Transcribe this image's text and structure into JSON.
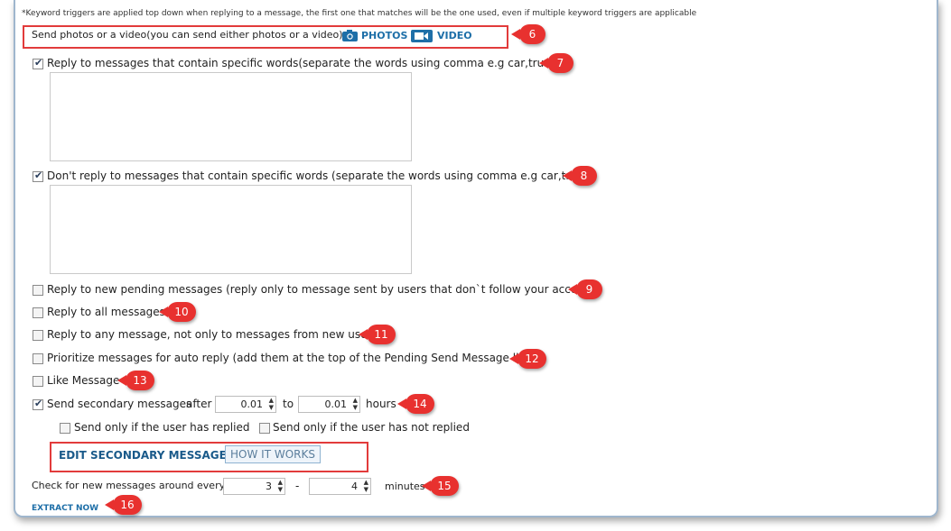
{
  "note": "*Keyword triggers are applied top down when replying to a message, the first one that matches will be the one used, even if multiple keyword triggers are applicable",
  "media": {
    "label": "Send photos or a video(you can send either photos or a video)",
    "photos_label": "PHOTOS",
    "video_label": "VIDEO",
    "photos_icon": "camera-icon",
    "video_icon": "video-camera-icon"
  },
  "options": {
    "specific_words": {
      "label": "Reply to messages that contain specific words(separate the words using comma e.g car,truck)",
      "checked": true
    },
    "exclude_words": {
      "label": "Don't reply to messages that contain specific words (separate the words using comma e.g car,truck)",
      "checked": true
    },
    "pending": {
      "label": "Reply to new pending messages (reply only to message sent by users that don`t follow your account)",
      "checked": false
    },
    "all": {
      "label": "Reply to all messages",
      "checked": false
    },
    "any": {
      "label": "Reply to any message, not only to messages from new users",
      "checked": false
    },
    "prioritize": {
      "label": "Prioritize messages for auto reply (add them at the top of the Pending Send Message list)",
      "checked": false
    },
    "like": {
      "label": "Like Message",
      "checked": false
    }
  },
  "secondary": {
    "label": "Send secondary messages",
    "after_label": "after",
    "from_value": "0.01",
    "to_label": "to",
    "to_value": "0.01",
    "unit": "hours",
    "checked": true,
    "replied_label": "Send only if the user has replied",
    "not_replied_label": "Send only if the user has not replied"
  },
  "edit_secondary": "EDIT SECONDARY MESSAGES",
  "how_it_works": "HOW IT WORKS",
  "check": {
    "label": "Check for new messages around every",
    "min_value": "3",
    "dash": "-",
    "max_value": "4",
    "unit": "minutes"
  },
  "extract_now": "EXTRACT NOW",
  "markers": [
    "6",
    "7",
    "8",
    "9",
    "10",
    "11",
    "12",
    "13",
    "14",
    "15",
    "16"
  ],
  "colors": {
    "accent": "#1e6fa8",
    "marker": "#e8312f",
    "highlight_box": "#e23b3b"
  }
}
